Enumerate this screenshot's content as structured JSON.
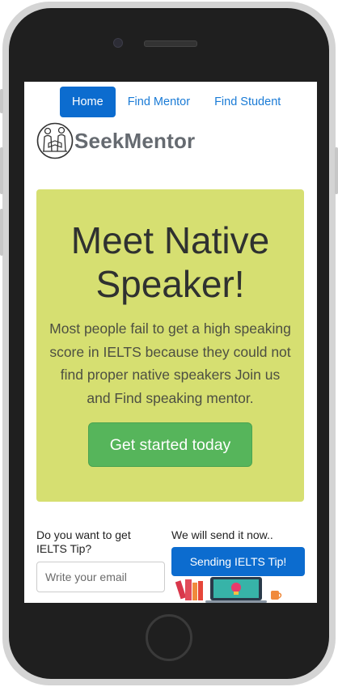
{
  "nav": {
    "items": [
      {
        "label": "Home",
        "active": true
      },
      {
        "label": "Find Mentor",
        "active": false
      },
      {
        "label": "Find Student",
        "active": false
      }
    ]
  },
  "brand": {
    "name": "SeekMentor",
    "logo_icon": "mentor-student-logo-icon"
  },
  "hero": {
    "title": "Meet Native Speaker!",
    "text": "Most people fail to get a high speaking score in IELTS because they could not find proper native speakers Join us and Find speaking mentor.",
    "cta_label": "Get started today",
    "bg_color": "#d6df71",
    "cta_color": "#56b55b"
  },
  "subscribe": {
    "question": "Do you want to get IELTS Tip?",
    "email_placeholder": "Write your email",
    "email_value": "",
    "promise": "We will send it now..",
    "button_label": "Sending IELTS Tip!",
    "button_color": "#0c6ccf",
    "illustration_icon": "books-laptop-illustration-icon"
  }
}
